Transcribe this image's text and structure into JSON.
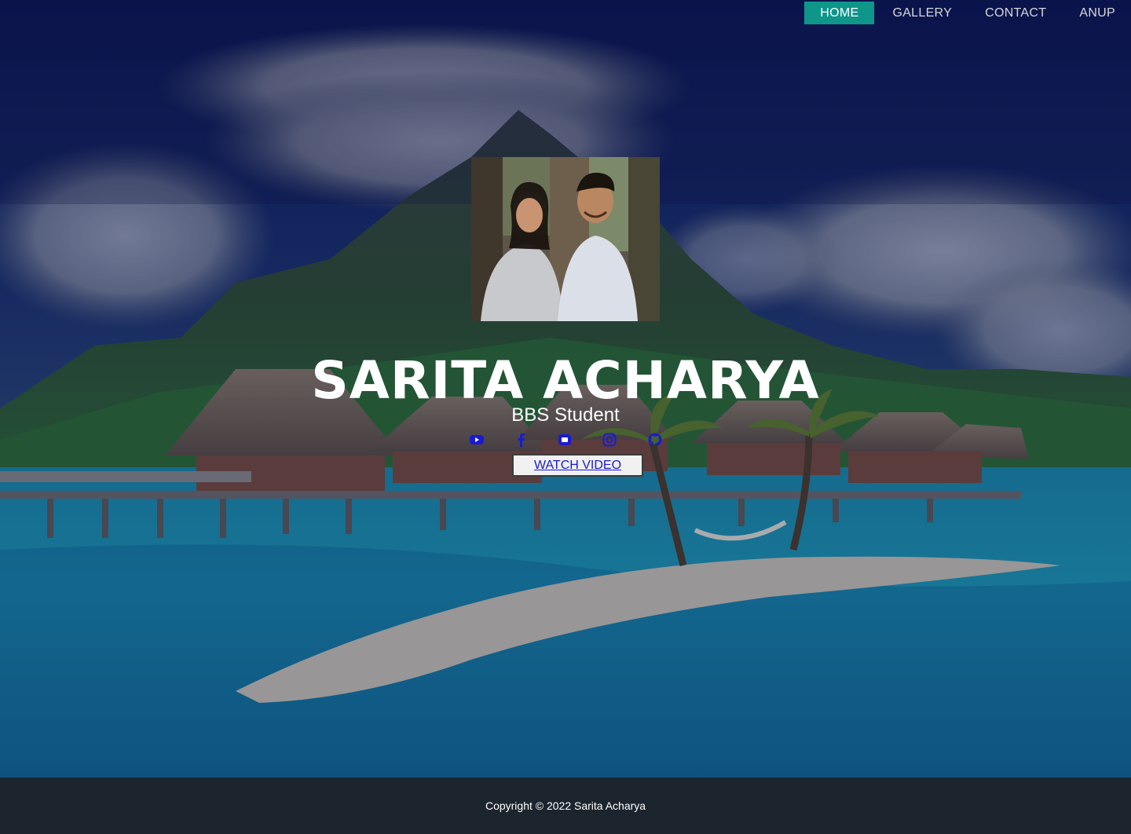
{
  "nav": {
    "items": [
      {
        "label": "HOME",
        "active": true
      },
      {
        "label": "GALLERY",
        "active": false
      },
      {
        "label": "CONTACT",
        "active": false
      },
      {
        "label": "ANUP",
        "active": false
      }
    ]
  },
  "profile": {
    "name": "SARITA ACHARYA",
    "role": "BBS Student",
    "photo_icon": "couple-photo"
  },
  "social": {
    "icons": [
      "youtube-icon",
      "facebook-icon",
      "square-icon",
      "instagram-icon",
      "github-icon"
    ],
    "color": "#1a1ad2"
  },
  "cta": {
    "watch_label": "WATCH VIDEO"
  },
  "footer": {
    "copyright": "Copyright © 2022 Sarita Acharya"
  },
  "colors": {
    "accent": "#0e968a",
    "footer_bg": "#1c242e",
    "overlay": "#0a1850"
  }
}
